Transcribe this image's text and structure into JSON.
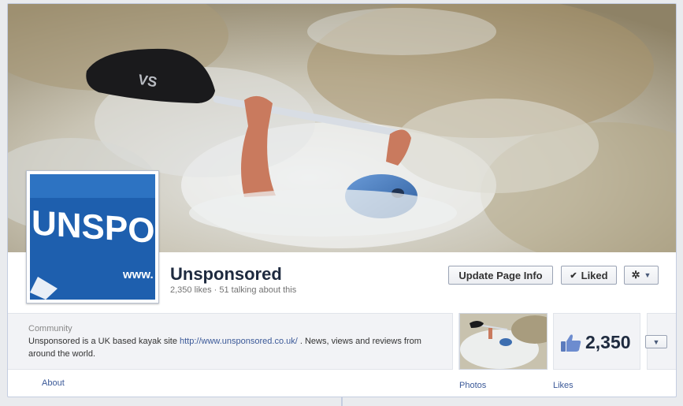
{
  "page": {
    "name": "Unsponsored",
    "stats": "2,350 likes · 51 talking about this"
  },
  "profile_picture": {
    "text": "UNSPO",
    "sub_text": "www."
  },
  "actions": {
    "update_label": "Update Page Info",
    "liked_label": "Liked",
    "gear_icon": "gear-icon"
  },
  "about": {
    "category": "Community",
    "text_before": "Unsponsored is a UK based kayak site ",
    "link": "http://www.unsponsored.co.uk/",
    "text_after": " . News, views and reviews from around the world.",
    "tab_label": "About"
  },
  "apps": {
    "photos_label": "Photos",
    "likes_label": "Likes",
    "likes_count": "2,350"
  },
  "colors": {
    "link": "#3b5998",
    "title": "#1e2a3f",
    "panel": "#f2f3f6"
  }
}
